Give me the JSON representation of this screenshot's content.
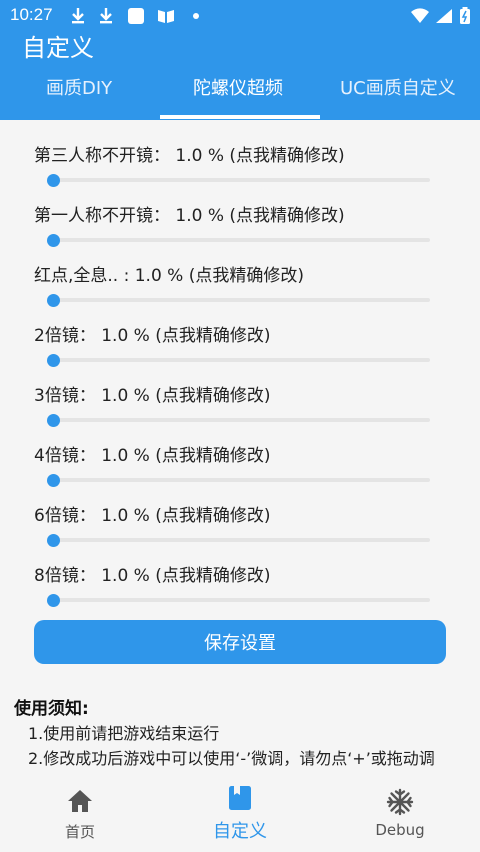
{
  "status_bar": {
    "time": "10:27"
  },
  "app_title": "自定义",
  "tabs": [
    {
      "label": "画质DIY"
    },
    {
      "label": "陀螺仪超频"
    },
    {
      "label": "UC画质自定义"
    }
  ],
  "settings": [
    {
      "label": "第三人称不开镜：  1.0 %  (点我精确修改)",
      "value": 1.0
    },
    {
      "label": "第一人称不开镜：  1.0 %  (点我精确修改)",
      "value": 1.0
    },
    {
      "label": "红点,全息.. :   1.0 %  (点我精确修改)",
      "value": 1.0
    },
    {
      "label": "2倍镜：  1.0 %  (点我精确修改)",
      "value": 1.0
    },
    {
      "label": "3倍镜：  1.0 %  (点我精确修改)",
      "value": 1.0
    },
    {
      "label": "4倍镜：  1.0 %  (点我精确修改)",
      "value": 1.0
    },
    {
      "label": "6倍镜：  1.0 %  (点我精确修改)",
      "value": 1.0
    },
    {
      "label": "8倍镜：  1.0 %  (点我精确修改)",
      "value": 1.0
    }
  ],
  "save_button": "保存设置",
  "notice": {
    "title": "使用须知:",
    "lines": [
      "1.使用前请把游戏结束运行",
      "2.修改成功后游戏中可以使用‘-’微调，请勿点‘+’或拖动调"
    ]
  },
  "bottom_nav": [
    {
      "label": "首页",
      "icon": "home-icon"
    },
    {
      "label": "自定义",
      "icon": "book-icon"
    },
    {
      "label": "Debug",
      "icon": "snowflake-icon"
    }
  ],
  "colors": {
    "accent": "#2f96ea",
    "background": "#f5f5f5"
  }
}
